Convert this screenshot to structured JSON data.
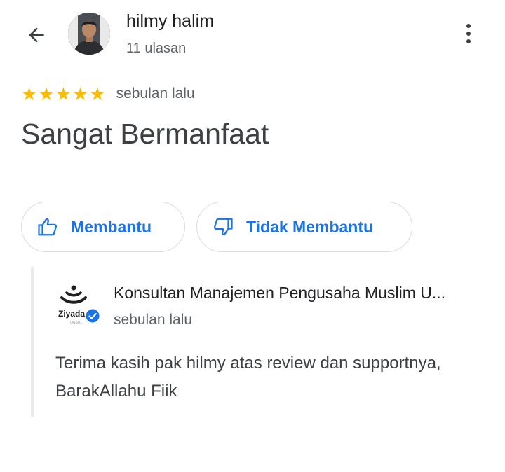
{
  "reviewer": {
    "name": "hilmy halim",
    "meta": "11 ulasan"
  },
  "rating": {
    "stars": 5,
    "date": "sebulan lalu"
  },
  "review": {
    "text": "Sangat Bermanfaat"
  },
  "buttons": {
    "helpful_label": "Membantu",
    "unhelpful_label": "Tidak Membantu"
  },
  "owner_reply": {
    "logo_text": "Ziyada",
    "name": "Konsultan Manajemen Pengusaha Muslim U...",
    "date": "sebulan lalu",
    "text": "Terima kasih pak hilmy atas review dan supportnya, BarakAllahu Fiik"
  },
  "colors": {
    "accent": "#1a73e8",
    "star": "#fbbc04",
    "secondary_text": "#5f6368",
    "border": "#dadce0"
  }
}
